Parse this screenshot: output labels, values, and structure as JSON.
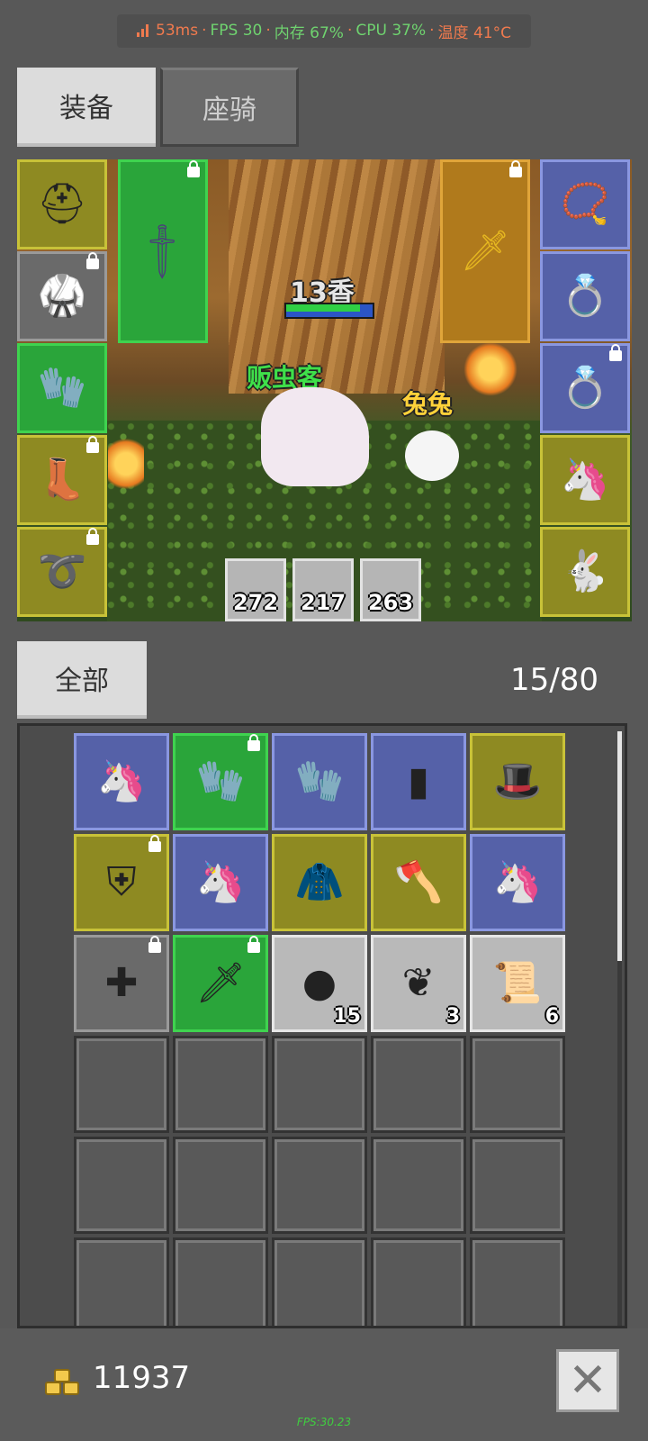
{
  "status": {
    "latency": "53ms",
    "fps": "FPS 30",
    "memory": "内存 67%",
    "cpu": "CPU 37%",
    "temperature": "温度 41°C"
  },
  "tabs": [
    {
      "label": "装备",
      "active": true
    },
    {
      "label": "座骑",
      "active": false
    }
  ],
  "scene": {
    "player_name": "贩虫客",
    "title_text": "13香",
    "pet_name": "兔兔",
    "hp_fraction": 0.85,
    "stats": [
      "272",
      "217",
      "263"
    ]
  },
  "equipment_left": [
    {
      "name": "helmet",
      "icon": "helmet-icon",
      "quality": "yellow",
      "locked": false
    },
    {
      "name": "armor",
      "icon": "armor-icon",
      "quality": "gray",
      "locked": true
    },
    {
      "name": "gloves",
      "icon": "gloves-icon",
      "quality": "green",
      "locked": false
    },
    {
      "name": "boots",
      "icon": "boots-icon",
      "quality": "yellow",
      "locked": true
    },
    {
      "name": "belt",
      "icon": "belt-icon",
      "quality": "yellow",
      "locked": true
    }
  ],
  "equipment_right": [
    {
      "name": "necklace",
      "icon": "necklace-icon",
      "quality": "blue",
      "locked": false
    },
    {
      "name": "ring",
      "icon": "ring-icon",
      "quality": "blue",
      "locked": false
    },
    {
      "name": "ring",
      "icon": "ring-icon",
      "quality": "blue",
      "locked": true
    },
    {
      "name": "mount",
      "icon": "unicorn-icon",
      "quality": "yellow",
      "locked": false
    },
    {
      "name": "pet",
      "icon": "rabbit-icon",
      "quality": "yellow",
      "locked": false
    }
  ],
  "weapon_main": {
    "icon": "sword-icon",
    "quality": "green",
    "locked": true
  },
  "weapon_off": {
    "icon": "gold-sword-icon",
    "quality": "orange",
    "locked": true
  },
  "inventory": {
    "filter_label": "全部",
    "capacity": "15/80",
    "items": [
      {
        "icon": "unicorn-icon",
        "quality": "blue",
        "locked": false,
        "qty": ""
      },
      {
        "icon": "gloves-icon",
        "quality": "green",
        "locked": true,
        "qty": ""
      },
      {
        "icon": "gloves-icon",
        "quality": "blue",
        "locked": false,
        "qty": ""
      },
      {
        "icon": "card-icon",
        "quality": "blue",
        "locked": false,
        "qty": ""
      },
      {
        "icon": "hat-icon",
        "quality": "yellow",
        "locked": false,
        "qty": ""
      },
      {
        "icon": "shield-icon",
        "quality": "yellow",
        "locked": true,
        "qty": ""
      },
      {
        "icon": "unicorn-icon",
        "quality": "blue",
        "locked": false,
        "qty": ""
      },
      {
        "icon": "cloak-icon",
        "quality": "yellow",
        "locked": false,
        "qty": ""
      },
      {
        "icon": "axe-icon",
        "quality": "yellow",
        "locked": false,
        "qty": ""
      },
      {
        "icon": "unicorn-icon",
        "quality": "blue",
        "locked": false,
        "qty": ""
      },
      {
        "icon": "mace-icon",
        "quality": "gray",
        "locked": true,
        "qty": ""
      },
      {
        "icon": "sword-icon",
        "quality": "green",
        "locked": true,
        "qty": ""
      },
      {
        "icon": "ore-icon",
        "quality": "light",
        "locked": false,
        "qty": "15"
      },
      {
        "icon": "feather-icon",
        "quality": "light",
        "locked": false,
        "qty": "3"
      },
      {
        "icon": "scroll-icon",
        "quality": "light",
        "locked": false,
        "qty": "6"
      }
    ]
  },
  "gold": "11937",
  "fps_footer": "FPS:30.23"
}
